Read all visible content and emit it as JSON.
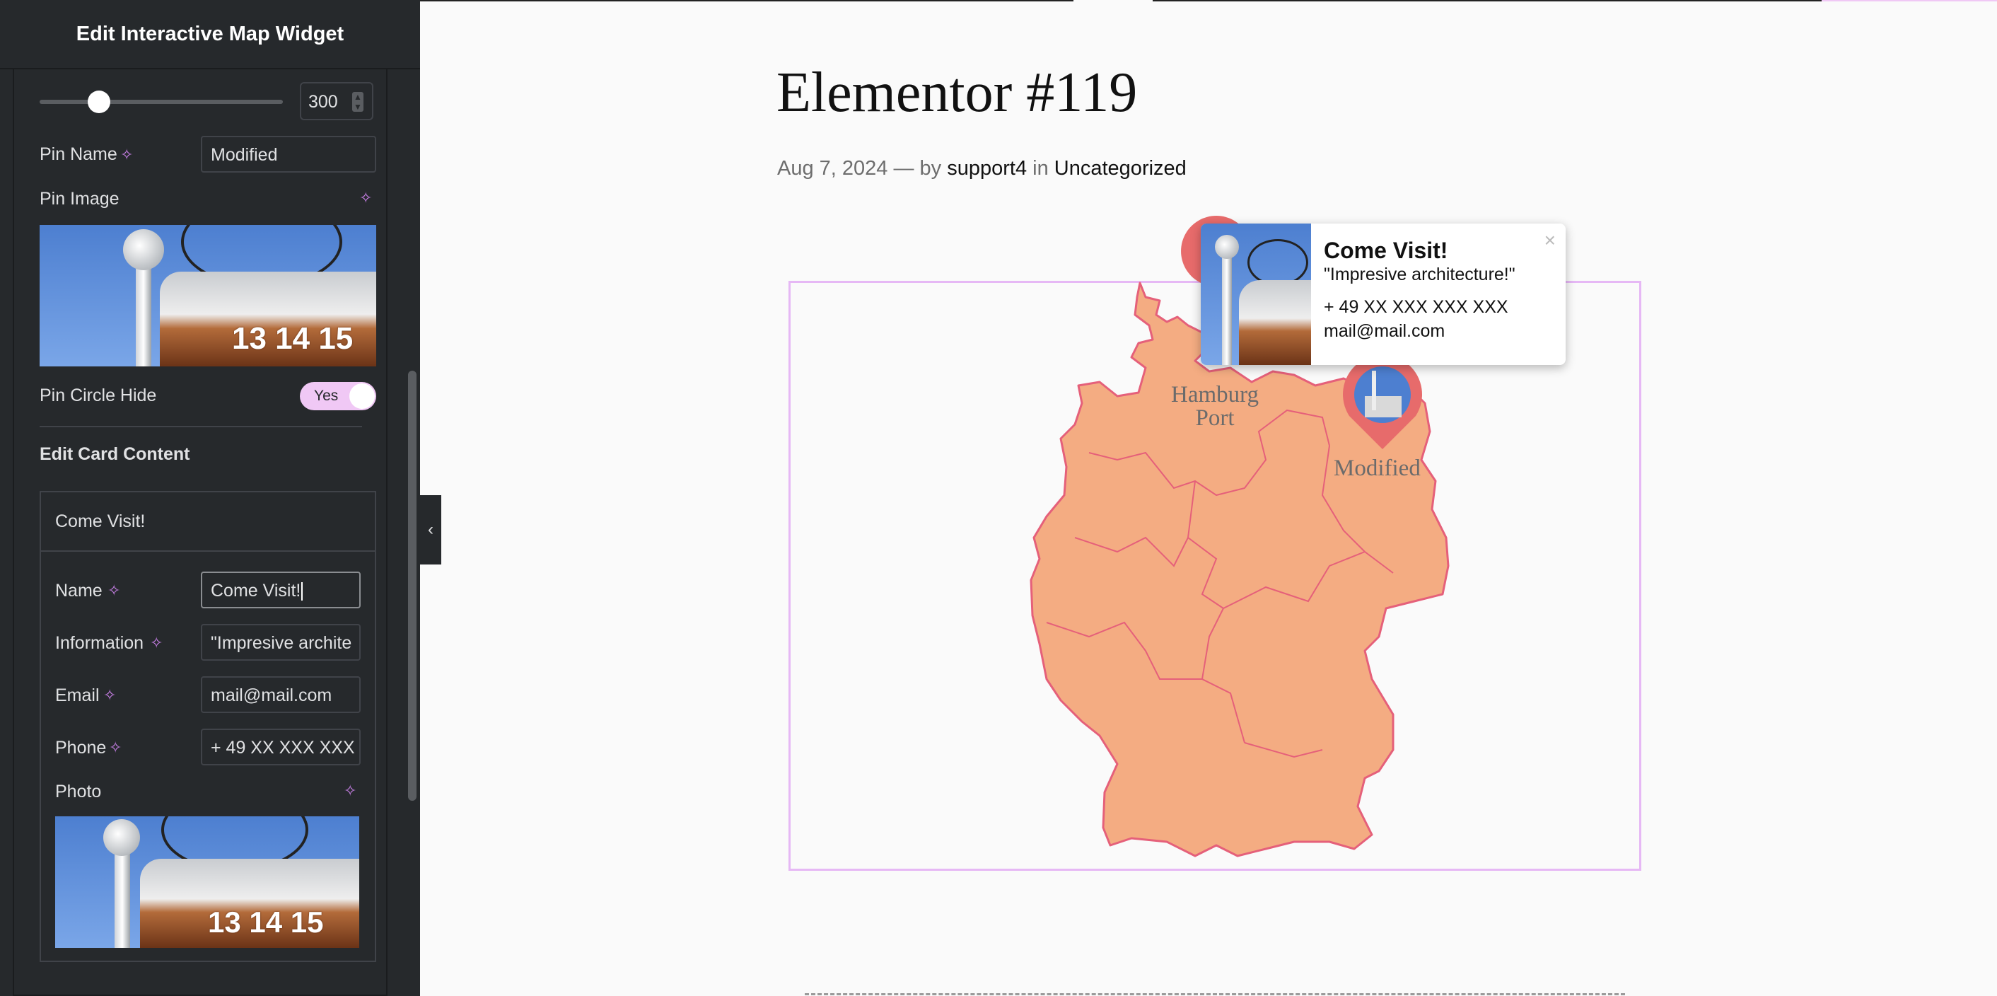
{
  "panel": {
    "title": "Edit Interactive Map Widget",
    "slider": {
      "value": "300",
      "fraction": 0.15
    },
    "pin_name": {
      "label": "Pin Name",
      "value": "Modified"
    },
    "pin_image": {
      "label": "Pin Image"
    },
    "pin_circle_hide": {
      "label": "Pin Circle Hide",
      "toggle_label": "Yes",
      "enabled": true
    },
    "card_section_title": "Edit Card Content",
    "repeater": {
      "item_title": "Come Visit!",
      "name": {
        "label": "Name",
        "value": "Come Visit!"
      },
      "information": {
        "label": "Information",
        "value": "\"Impresive archite"
      },
      "email": {
        "label": "Email",
        "value": "mail@mail.com"
      },
      "phone": {
        "label": "Phone",
        "value": "+ 49 XX XXX XXX"
      },
      "photo": {
        "label": "Photo"
      }
    },
    "photo_digits": "13 14 15"
  },
  "preview": {
    "post_title": "Elementor #119",
    "meta": {
      "date": "Aug 7, 2024",
      "sep": "— by",
      "author": "support4",
      "in": "in",
      "category": "Uncategorized"
    },
    "map": {
      "fill_color": "#f4ac82",
      "border_color": "#e5607a",
      "pins": [
        {
          "label_line1": "Hamburg",
          "label_line2": "Port"
        },
        {
          "label_line1": "Modified"
        }
      ]
    },
    "card": {
      "title": "Come Visit!",
      "information": "\"Impresive architecture!\"",
      "phone": "+ 49 XX XXX XXX XXX",
      "email": "mail@mail.com",
      "close_icon": "×"
    }
  },
  "colors": {
    "accent": "#c77fe6",
    "panel_bg": "#26292c",
    "pin": "#e76b6b"
  }
}
